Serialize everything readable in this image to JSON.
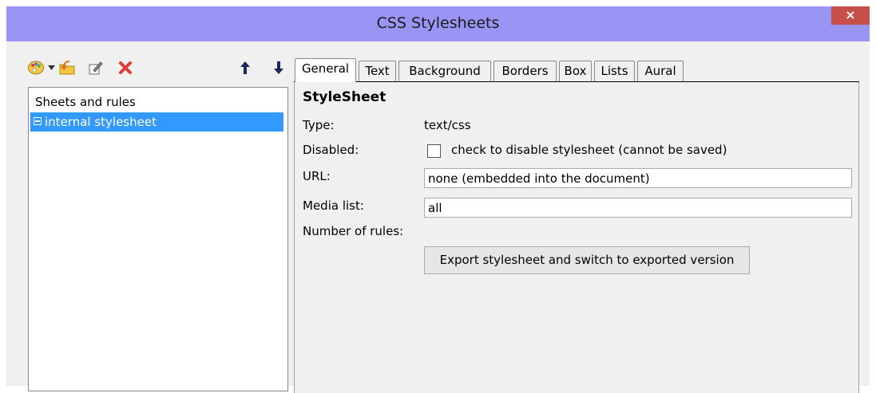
{
  "window": {
    "title": "CSS Stylesheets",
    "close_glyph": "×"
  },
  "toolbar": {
    "icons": [
      "palette-icon",
      "dropdown-arrow-icon",
      "import-icon",
      "edit-icon",
      "delete-icon",
      "move-up-icon",
      "move-down-icon"
    ]
  },
  "tree": {
    "header": "Sheets and rules",
    "items": [
      {
        "label": "internal stylesheet",
        "expanded": true
      }
    ]
  },
  "tabs": [
    {
      "label": "General",
      "active": true
    },
    {
      "label": "Text"
    },
    {
      "label": "Background"
    },
    {
      "label": "Borders"
    },
    {
      "label": "Box"
    },
    {
      "label": "Lists"
    },
    {
      "label": "Aural"
    }
  ],
  "panel": {
    "title": "StyleSheet",
    "type_label": "Type:",
    "type_value": "text/css",
    "disabled_label": "Disabled:",
    "disabled_checkbox_label": "check to disable stylesheet (cannot be saved)",
    "url_label": "URL:",
    "url_value": "none (embedded into the document)",
    "media_label": "Media list:",
    "media_value": "all",
    "rules_label": "Number of rules:",
    "export_button": "Export stylesheet and switch to exported version"
  },
  "colors": {
    "title_bar": "#9a95f5",
    "selection": "#3399ff",
    "close": "#c7504a"
  }
}
